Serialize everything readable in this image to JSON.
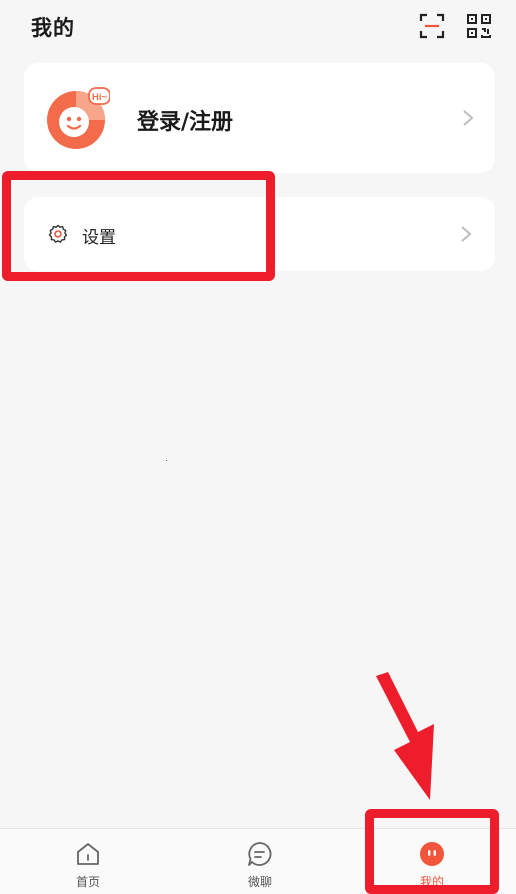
{
  "header": {
    "title": "我的",
    "icons": [
      "scan-icon",
      "qr-code-icon"
    ]
  },
  "login_card": {
    "avatar_badge": "Hi~",
    "label": "登录/注册",
    "icon": "chevron-right-icon"
  },
  "settings_card": {
    "icon": "gear-icon",
    "label": "设置"
  },
  "bottom_nav": {
    "items": [
      {
        "label": "首页",
        "icon": "home-icon",
        "active": false
      },
      {
        "label": "微聊",
        "icon": "chat-bubble-icon",
        "active": false
      },
      {
        "label": "我的",
        "icon": "mine-face-icon",
        "active": true
      }
    ]
  },
  "colors": {
    "accent": "#f2553b",
    "annotation_red": "#ee1d2b",
    "background": "#f6f6f7",
    "card": "#ffffff"
  }
}
